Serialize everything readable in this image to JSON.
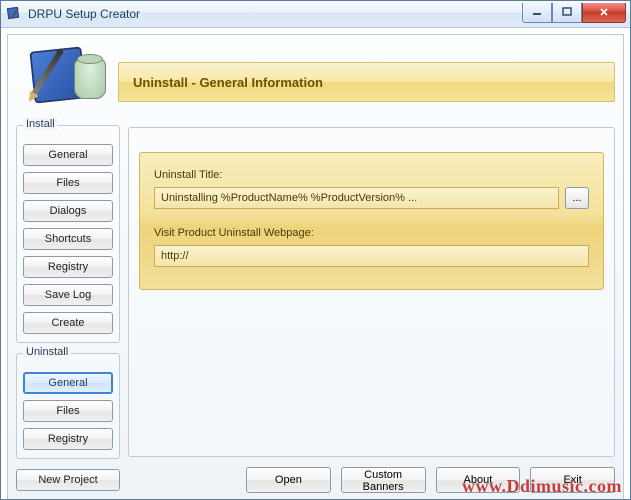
{
  "window": {
    "title": "DRPU Setup Creator"
  },
  "header": {
    "page_title": "Uninstall - General Information"
  },
  "sidebar": {
    "install": {
      "label": "Install",
      "items": [
        {
          "label": "General"
        },
        {
          "label": "Files"
        },
        {
          "label": "Dialogs"
        },
        {
          "label": "Shortcuts"
        },
        {
          "label": "Registry"
        },
        {
          "label": "Save Log"
        },
        {
          "label": "Create"
        }
      ]
    },
    "uninstall": {
      "label": "Uninstall",
      "items": [
        {
          "label": "General"
        },
        {
          "label": "Files"
        },
        {
          "label": "Registry"
        }
      ]
    },
    "new_project_label": "New Project"
  },
  "form": {
    "uninstall_title_label": "Uninstall Title:",
    "uninstall_title_value": "Uninstalling %ProductName% %ProductVersion% ...",
    "browse_label": "...",
    "webpage_label": "Visit Product Uninstall Webpage:",
    "webpage_value": "http://"
  },
  "bottom": {
    "open": "Open",
    "custom_banners": "Custom Banners",
    "about": "About",
    "exit": "Exit"
  },
  "watermark": {
    "prefix": "www.",
    "mid": "Ddimusic",
    "suffix": ".com"
  }
}
